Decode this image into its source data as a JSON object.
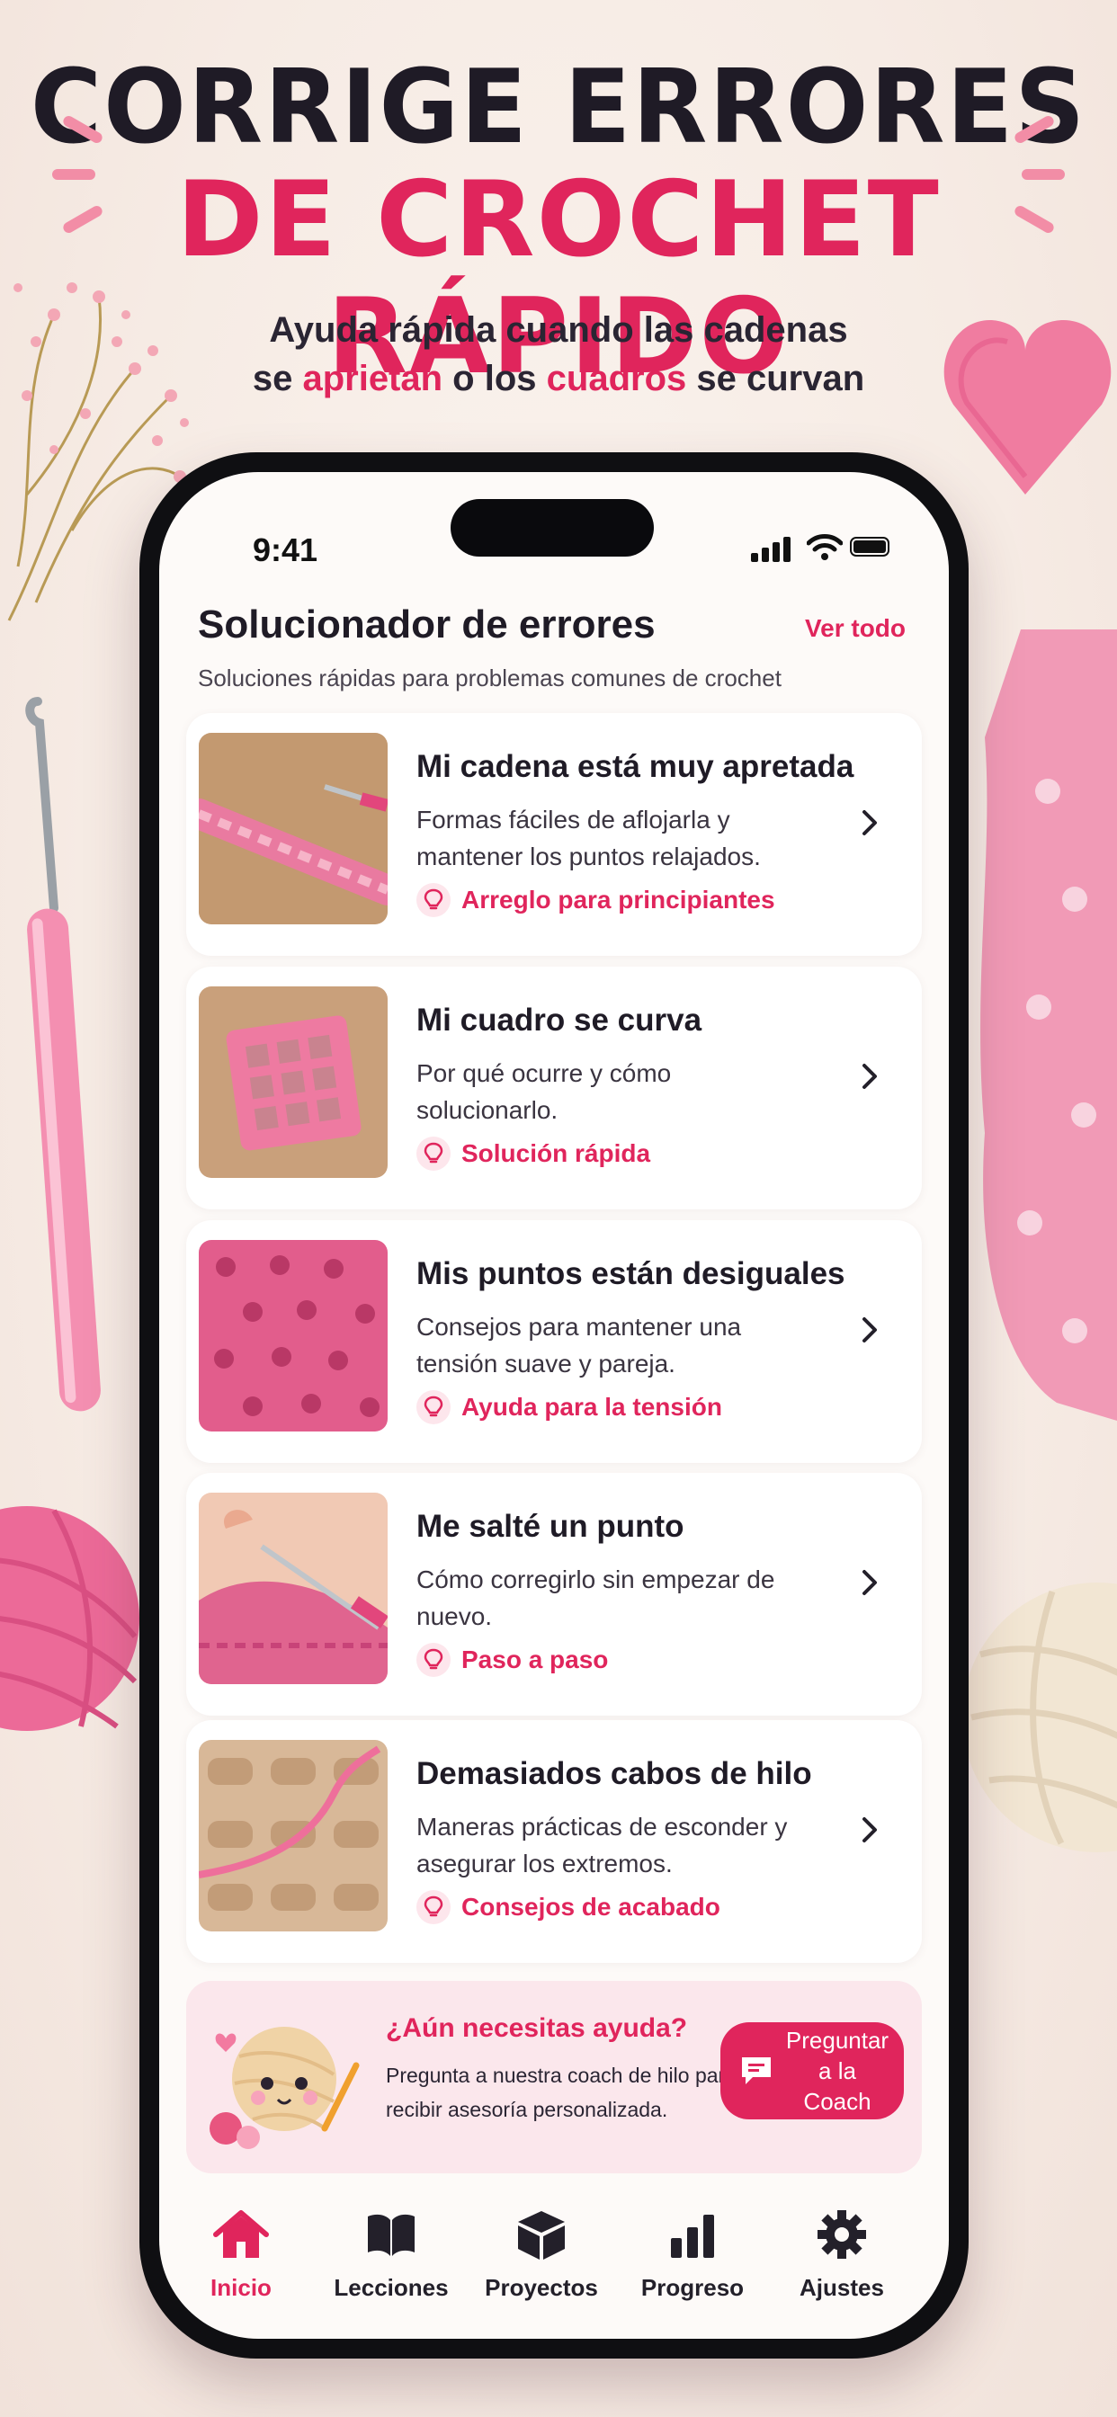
{
  "headline": {
    "line1": "CORRIGE ERRORES",
    "line2": "DE CROCHET RÁPIDO",
    "sub_line1": "Ayuda rápida cuando las cadenas",
    "sub_pre": "se ",
    "sub_accent1": "aprietan",
    "sub_mid": " o los ",
    "sub_accent2": "cuadros",
    "sub_post": " se curvan"
  },
  "status_bar": {
    "time": "9:41"
  },
  "section": {
    "title": "Solucionador de errores",
    "see_all": "Ver todo",
    "subtitle": "Soluciones rápidas para problemas comunes de crochet"
  },
  "cards": [
    {
      "title": "Mi cadena está muy apretada",
      "desc": "Formas fáciles de aflojarla y mantener los puntos relajados.",
      "tag": "Arreglo para principiantes"
    },
    {
      "title": "Mi cuadro se curva",
      "desc": "Por qué ocurre y cómo solucionarlo.",
      "tag": "Solución rápida"
    },
    {
      "title": "Mis puntos están desiguales",
      "desc": "Consejos para mantener una tensión suave y pareja.",
      "tag": "Ayuda para la tensión"
    },
    {
      "title": "Me salté un punto",
      "desc": "Cómo corregirlo sin empezar de nuevo.",
      "tag": "Paso a paso"
    },
    {
      "title": "Demasiados cabos de hilo",
      "desc": "Maneras prácticas de esconder y asegurar los extremos.",
      "tag": "Consejos de acabado"
    }
  ],
  "help": {
    "title": "¿Aún necesitas ayuda?",
    "desc": "Pregunta a nuestra coach de hilo para recibir asesoría personalizada.",
    "button": "Preguntar a la Coach"
  },
  "tabs": [
    {
      "label": "Inicio",
      "icon": "home-icon",
      "active": true
    },
    {
      "label": "Lecciones",
      "icon": "book-icon"
    },
    {
      "label": "Proyectos",
      "icon": "box-icon"
    },
    {
      "label": "Progreso",
      "icon": "bar-chart-icon"
    },
    {
      "label": "Ajustes",
      "icon": "gear-icon"
    }
  ],
  "colors": {
    "accent": "#e0255c",
    "ink": "#1f1b26",
    "background": "#f6ebe4",
    "help_bg": "#fbe7ec"
  }
}
